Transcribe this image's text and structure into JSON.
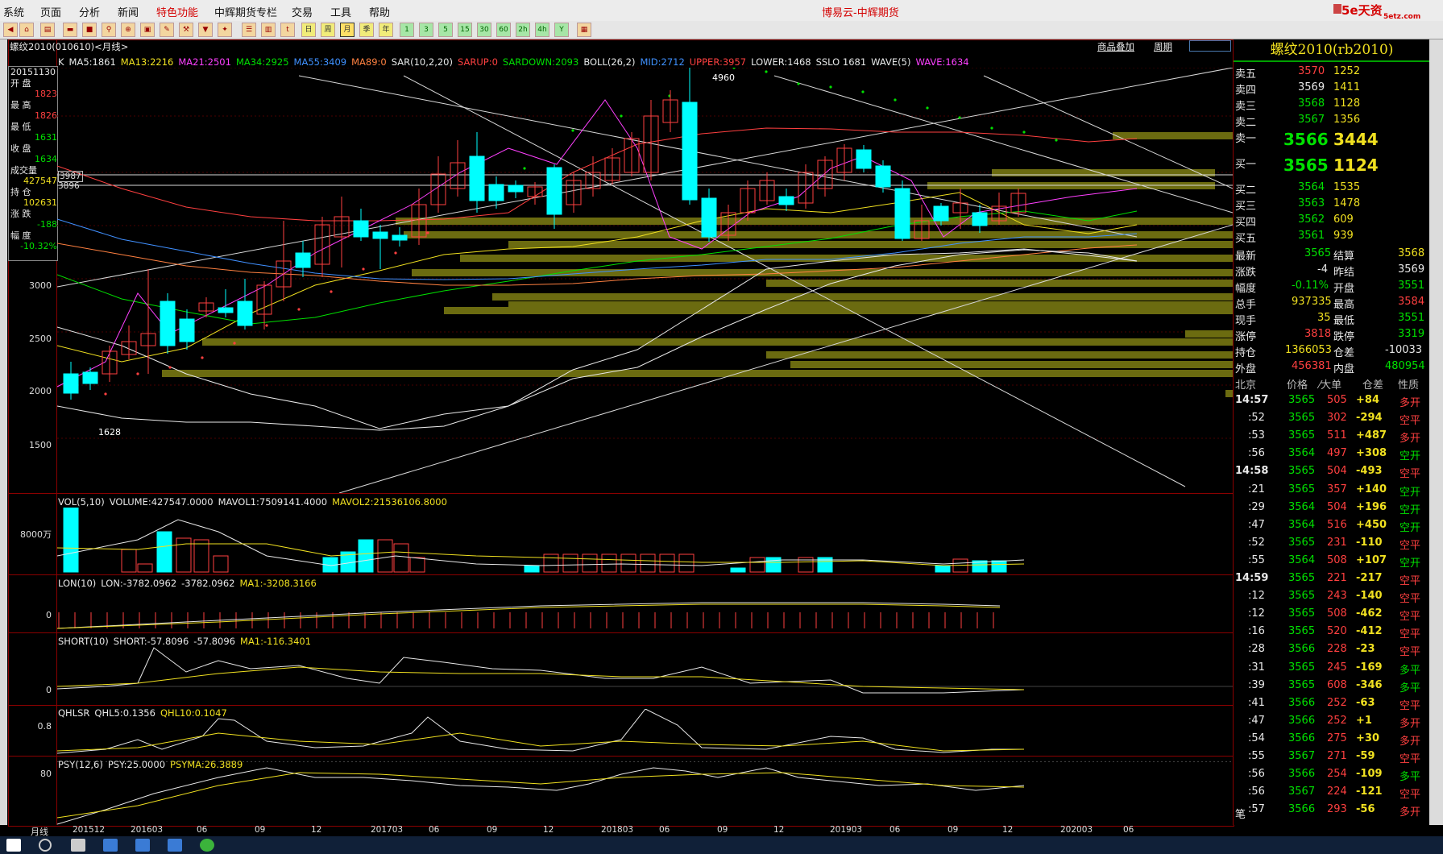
{
  "menubar": {
    "items": [
      "系统",
      "页面",
      "分析",
      "新闻",
      "特色功能",
      "中辉期货专栏",
      "交易",
      "工具",
      "帮助"
    ],
    "highlight": "特色功能",
    "app_title": "博易云-中辉期货",
    "logo": "5e天资",
    "logo_sub": "5etz.com"
  },
  "toolbar": {
    "periods": [
      "日",
      "周",
      "月",
      "季",
      "年",
      "1",
      "3",
      "5",
      "15",
      "30",
      "60",
      "2h",
      "4h",
      "Y"
    ],
    "active_period": "月"
  },
  "chart": {
    "header_title": "螺纹2010(010610)<月线>",
    "overlay_link": "商品叠加",
    "period_link": "周期",
    "main_indicators": [
      {
        "text": "K",
        "color": "#e8e8e8"
      },
      {
        "text": "MA5:1861",
        "color": "#e8e8e8"
      },
      {
        "text": "MA13:2216",
        "color": "#f0e020"
      },
      {
        "text": "MA21:2501",
        "color": "#ff40ff"
      },
      {
        "text": "MA34:2925",
        "color": "#00e000"
      },
      {
        "text": "MA55:3409",
        "color": "#4090ff"
      },
      {
        "text": "MA89:0",
        "color": "#ff8040"
      },
      {
        "text": "SAR(10,2,20)",
        "color": "#e8e8e8"
      },
      {
        "text": "SARUP:0",
        "color": "#ff4040"
      },
      {
        "text": "SARDOWN:2093",
        "color": "#00e000"
      },
      {
        "text": "BOLL(26,2)",
        "color": "#e8e8e8"
      },
      {
        "text": "MID:2712",
        "color": "#4090ff"
      },
      {
        "text": "UPPER:3957",
        "color": "#ff4040"
      },
      {
        "text": "LOWER:1468",
        "color": "#e8e8e8"
      },
      {
        "text": "SSLO 1681",
        "color": "#e8e8e8"
      },
      {
        "text": "WAVE(5)",
        "color": "#e8e8e8"
      },
      {
        "text": "WAVE:1634",
        "color": "#ff40ff"
      }
    ],
    "price_axis": [
      "3000",
      "2500",
      "2000",
      "1500"
    ],
    "max_label": "4960",
    "min_label": "1628",
    "price_tags": [
      "3987",
      "3896"
    ],
    "x_axis": [
      "201512",
      "201603",
      "06",
      "09",
      "12",
      "201703",
      "06",
      "09",
      "12",
      "201803",
      "06",
      "09",
      "12",
      "201903",
      "06",
      "09",
      "12",
      "202003",
      "06"
    ],
    "x_axis_title": "月线",
    "info_box": [
      {
        "text": "20151130",
        "color": "#e8e8e8"
      },
      {
        "text": "开  盘",
        "color": "#e8e8e8"
      },
      {
        "text": "1823",
        "color": "#ff4040"
      },
      {
        "text": "最  高",
        "color": "#e8e8e8"
      },
      {
        "text": "1826",
        "color": "#ff4040"
      },
      {
        "text": "最  低",
        "color": "#e8e8e8"
      },
      {
        "text": "1631",
        "color": "#00e000"
      },
      {
        "text": "收  盘",
        "color": "#e8e8e8"
      },
      {
        "text": "1634",
        "color": "#00e000"
      },
      {
        "text": "成交量",
        "color": "#e8e8e8"
      },
      {
        "text": "427547",
        "color": "#f0e020"
      },
      {
        "text": "持  仓",
        "color": "#e8e8e8"
      },
      {
        "text": "102631",
        "color": "#f0e020"
      },
      {
        "text": "涨  跌",
        "color": "#e8e8e8"
      },
      {
        "text": "-188",
        "color": "#00e000"
      },
      {
        "text": "幅  度",
        "color": "#e8e8e8"
      },
      {
        "text": "-10.32%",
        "color": "#00e000"
      }
    ],
    "volume_panel": {
      "labels": [
        {
          "text": "VOL(5,10)",
          "color": "#e8e8e8"
        },
        {
          "text": "VOLUME:427547.0000",
          "color": "#e8e8e8"
        },
        {
          "text": "MAVOL1:7509141.4000",
          "color": "#e8e8e8"
        },
        {
          "text": "MAVOL2:21536106.8000",
          "color": "#f0e020"
        }
      ],
      "axis": "8000万"
    },
    "lon_panel": {
      "labels": [
        {
          "text": "LON(10)",
          "color": "#e8e8e8"
        },
        {
          "text": "LON:-3782.0962",
          "color": "#e8e8e8"
        },
        {
          "text": "-3782.0962",
          "color": "#e8e8e8"
        },
        {
          "text": "MA1:-3208.3166",
          "color": "#f0e020"
        }
      ],
      "axis": "0"
    },
    "short_panel": {
      "labels": [
        {
          "text": "SHORT(10)",
          "color": "#e8e8e8"
        },
        {
          "text": "SHORT:-57.8096",
          "color": "#e8e8e8"
        },
        {
          "text": "-57.8096",
          "color": "#e8e8e8"
        },
        {
          "text": "MA1:-116.3401",
          "color": "#f0e020"
        }
      ],
      "axis": "0"
    },
    "qhlsr_panel": {
      "labels": [
        {
          "text": "QHLSR",
          "color": "#e8e8e8"
        },
        {
          "text": "QHL5:0.1356",
          "color": "#e8e8e8"
        },
        {
          "text": "QHL10:0.1047",
          "color": "#f0e020"
        }
      ],
      "axis": "0.8"
    },
    "psy_panel": {
      "labels": [
        {
          "text": "PSY(12,6)",
          "color": "#e8e8e8"
        },
        {
          "text": "PSY:25.0000",
          "color": "#e8e8e8"
        },
        {
          "text": "PSYMA:26.3889",
          "color": "#f0e020"
        }
      ],
      "axis": "80"
    }
  },
  "quote": {
    "title": "螺纹2010(rb2010)",
    "asks": [
      {
        "label": "卖五",
        "price": "3570",
        "vol": "1252",
        "pcolor": "#ff4040"
      },
      {
        "label": "卖四",
        "price": "3569",
        "vol": "1411",
        "pcolor": "#e8e8e8"
      },
      {
        "label": "卖三",
        "price": "3568",
        "vol": "1128",
        "pcolor": "#00e000"
      },
      {
        "label": "卖二",
        "price": "3567",
        "vol": "1356",
        "pcolor": "#00e000"
      }
    ],
    "ask1": {
      "label": "卖一",
      "price": "3566",
      "vol": "3444"
    },
    "bid1": {
      "label": "买一",
      "price": "3565",
      "vol": "1124"
    },
    "bids": [
      {
        "label": "买二",
        "price": "3564",
        "vol": "1535"
      },
      {
        "label": "买三",
        "price": "3563",
        "vol": "1478"
      },
      {
        "label": "买四",
        "price": "3562",
        "vol": "609"
      },
      {
        "label": "买五",
        "price": "3561",
        "vol": "939"
      }
    ],
    "stats": [
      {
        "l1": "最新",
        "v1": "3565",
        "c1": "#00e000",
        "l2": "结算",
        "v2": "3568",
        "c2": "#f0e020"
      },
      {
        "l1": "涨跌",
        "v1": "-4",
        "c1": "#e8e8e8",
        "l2": "昨结",
        "v2": "3569",
        "c2": "#e8e8e8"
      },
      {
        "l1": "幅度",
        "v1": "-0.11%",
        "c1": "#00e000",
        "l2": "开盘",
        "v2": "3551",
        "c2": "#00e000"
      },
      {
        "l1": "总手",
        "v1": "937335",
        "c1": "#f0e020",
        "l2": "最高",
        "v2": "3584",
        "c2": "#ff4040"
      },
      {
        "l1": "现手",
        "v1": "35",
        "c1": "#f0e020",
        "l2": "最低",
        "v2": "3551",
        "c2": "#00e000"
      },
      {
        "l1": "涨停",
        "v1": "3818",
        "c1": "#ff4040",
        "l2": "跌停",
        "v2": "3319",
        "c2": "#00e000"
      },
      {
        "l1": "持仓",
        "v1": "1366053",
        "c1": "#f0e020",
        "l2": "仓差",
        "v2": "-10033",
        "c2": "#e8e8e8"
      },
      {
        "l1": "外盘",
        "v1": "456381",
        "c1": "#ff4040",
        "l2": "内盘",
        "v2": "480954",
        "c2": "#00e000"
      }
    ],
    "tick_header": {
      "time": "北京",
      "price": "价格",
      "vol": "⁄大单",
      "oi": "仓差",
      "nature": "性质"
    },
    "ticks": [
      {
        "t": "14:57",
        "p": "3565",
        "v": "505",
        "d": "+84",
        "n": "多开",
        "nc": "#ff4040"
      },
      {
        "t": ":52",
        "p": "3565",
        "v": "302",
        "d": "-294",
        "n": "空平",
        "nc": "#ff4040"
      },
      {
        "t": ":53",
        "p": "3565",
        "v": "511",
        "d": "+487",
        "n": "多开",
        "nc": "#ff4040"
      },
      {
        "t": ":56",
        "p": "3564",
        "v": "497",
        "d": "+308",
        "n": "空开",
        "nc": "#00e000"
      },
      {
        "t": "14:58",
        "p": "3565",
        "v": "504",
        "d": "-493",
        "n": "空平",
        "nc": "#ff4040"
      },
      {
        "t": ":21",
        "p": "3565",
        "v": "357",
        "d": "+140",
        "n": "空开",
        "nc": "#00e000"
      },
      {
        "t": ":29",
        "p": "3564",
        "v": "504",
        "d": "+196",
        "n": "空开",
        "nc": "#00e000"
      },
      {
        "t": ":47",
        "p": "3564",
        "v": "516",
        "d": "+450",
        "n": "空开",
        "nc": "#00e000"
      },
      {
        "t": ":52",
        "p": "3565",
        "v": "231",
        "d": "-110",
        "n": "空平",
        "nc": "#ff4040"
      },
      {
        "t": ":55",
        "p": "3564",
        "v": "508",
        "d": "+107",
        "n": "空开",
        "nc": "#00e000"
      },
      {
        "t": "14:59",
        "p": "3565",
        "v": "221",
        "d": "-217",
        "n": "空平",
        "nc": "#ff4040"
      },
      {
        "t": ":12",
        "p": "3565",
        "v": "243",
        "d": "-140",
        "n": "空平",
        "nc": "#ff4040"
      },
      {
        "t": ":12",
        "p": "3565",
        "v": "508",
        "d": "-462",
        "n": "空平",
        "nc": "#ff4040"
      },
      {
        "t": ":16",
        "p": "3565",
        "v": "520",
        "d": "-412",
        "n": "空平",
        "nc": "#ff4040"
      },
      {
        "t": ":28",
        "p": "3566",
        "v": "228",
        "d": "-23",
        "n": "空平",
        "nc": "#ff4040"
      },
      {
        "t": ":31",
        "p": "3565",
        "v": "245",
        "d": "-169",
        "n": "多平",
        "nc": "#00e000"
      },
      {
        "t": ":39",
        "p": "3565",
        "v": "608",
        "d": "-346",
        "n": "多平",
        "nc": "#00e000"
      },
      {
        "t": ":41",
        "p": "3566",
        "v": "252",
        "d": "-63",
        "n": "空平",
        "nc": "#ff4040"
      },
      {
        "t": ":47",
        "p": "3566",
        "v": "252",
        "d": "+1",
        "n": "多开",
        "nc": "#ff4040"
      },
      {
        "t": ":54",
        "p": "3566",
        "v": "275",
        "d": "+30",
        "n": "多开",
        "nc": "#ff4040"
      },
      {
        "t": ":55",
        "p": "3567",
        "v": "271",
        "d": "-59",
        "n": "空平",
        "nc": "#ff4040"
      },
      {
        "t": ":56",
        "p": "3566",
        "v": "254",
        "d": "-109",
        "n": "多平",
        "nc": "#00e000"
      },
      {
        "t": ":56",
        "p": "3567",
        "v": "224",
        "d": "-121",
        "n": "空平",
        "nc": "#ff4040"
      },
      {
        "t": ":57",
        "p": "3566",
        "v": "293",
        "d": "-56",
        "n": "多开",
        "nc": "#ff4040"
      }
    ],
    "footer_tab": "笔"
  },
  "colors": {
    "up": "#ff4040",
    "down": "#00ffff",
    "frame": "#8b0000",
    "band": "#6b6b10"
  }
}
